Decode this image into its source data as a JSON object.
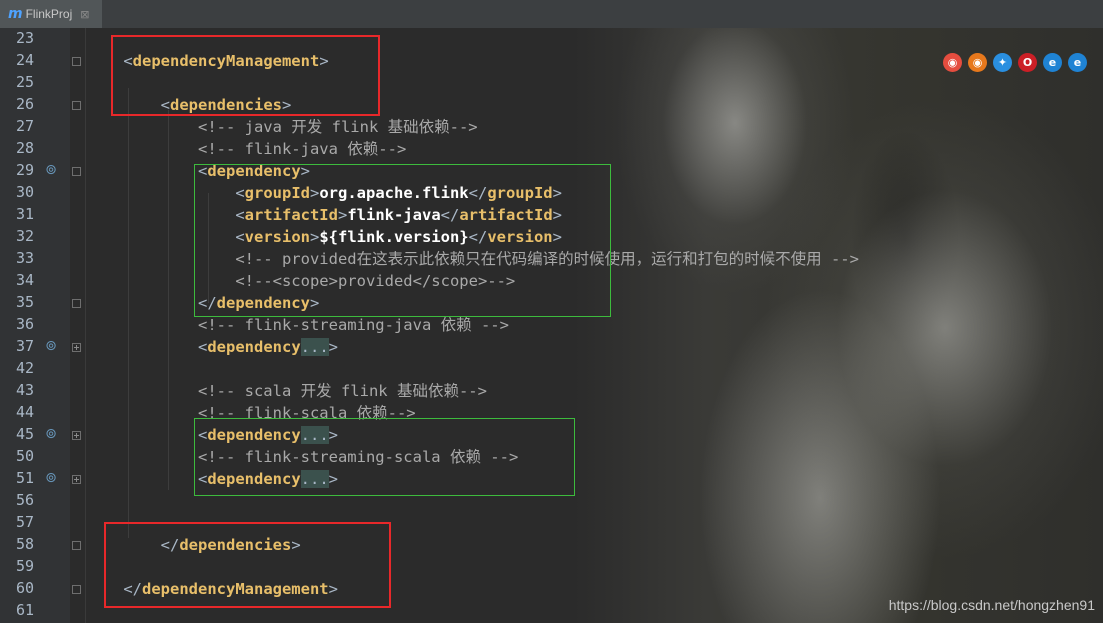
{
  "tab": {
    "icon": "m",
    "title": "FlinkProj",
    "close": "⊠"
  },
  "browser_icons": [
    {
      "name": "chrome-icon",
      "color": "#e54d3f"
    },
    {
      "name": "firefox-icon",
      "color": "#e7781c"
    },
    {
      "name": "safari-icon",
      "color": "#2a8fe0"
    },
    {
      "name": "opera-icon",
      "color": "#cc1f26"
    },
    {
      "name": "ie-icon",
      "color": "#1f83d4"
    },
    {
      "name": "edge-icon",
      "color": "#1f83d4"
    }
  ],
  "code": {
    "l23": "",
    "l24": {
      "lt": "<",
      "tag": "dependencyManagement",
      "gt": ">"
    },
    "l25": "",
    "l26": {
      "lt": "<",
      "tag": "dependencies",
      "gt": ">"
    },
    "l27": "<!-- java 开发 flink 基础依赖-->",
    "l28": "<!-- flink-java 依赖-->",
    "l29": {
      "lt": "<",
      "tag": "dependency",
      "gt": ">"
    },
    "l30": {
      "lt": "<",
      "tag": "groupId",
      "gt": ">",
      "value": "org.apache.flink",
      "lt2": "</",
      "tag2": "groupId",
      "gt2": ">"
    },
    "l31": {
      "lt": "<",
      "tag": "artifactId",
      "gt": ">",
      "value": "flink-java",
      "lt2": "</",
      "tag2": "artifactId",
      "gt2": ">"
    },
    "l32": {
      "lt": "<",
      "tag": "version",
      "gt": ">",
      "value": "${flink.version}",
      "lt2": "</",
      "tag2": "version",
      "gt2": ">"
    },
    "l33": "<!-- provided在这表示此依赖只在代码编译的时候使用，运行和打包的时候不使用 -->",
    "l34": "<!--<scope>provided</scope>-->",
    "l35": {
      "lt": "</",
      "tag": "dependency",
      "gt": ">"
    },
    "l36": "<!-- flink-streaming-java 依赖 -->",
    "l37": {
      "lt": "<",
      "tag": "dependency",
      "fold": "...",
      "gt": ">"
    },
    "l42": "",
    "l43": "<!-- scala 开发 flink 基础依赖-->",
    "l44": "<!-- flink-scala 依赖-->",
    "l45": {
      "lt": "<",
      "tag": "dependency",
      "fold": "...",
      "gt": ">"
    },
    "l50": "<!-- flink-streaming-scala 依赖 -->",
    "l51": {
      "lt": "<",
      "tag": "dependency",
      "fold": "...",
      "gt": ">"
    },
    "l56": "",
    "l57": "",
    "l58": {
      "lt": "</",
      "tag": "dependencies",
      "gt": ">"
    },
    "l59": "",
    "l60": {
      "lt": "</",
      "tag": "dependencyManagement",
      "gt": ">"
    },
    "l61": ""
  },
  "line_numbers": [
    "23",
    "24",
    "25",
    "26",
    "27",
    "28",
    "29",
    "30",
    "31",
    "32",
    "33",
    "34",
    "35",
    "36",
    "37",
    "42",
    "43",
    "44",
    "45",
    "50",
    "51",
    "56",
    "57",
    "58",
    "59",
    "60",
    "61"
  ],
  "watermark": "https://blog.csdn.net/hongzhen91"
}
